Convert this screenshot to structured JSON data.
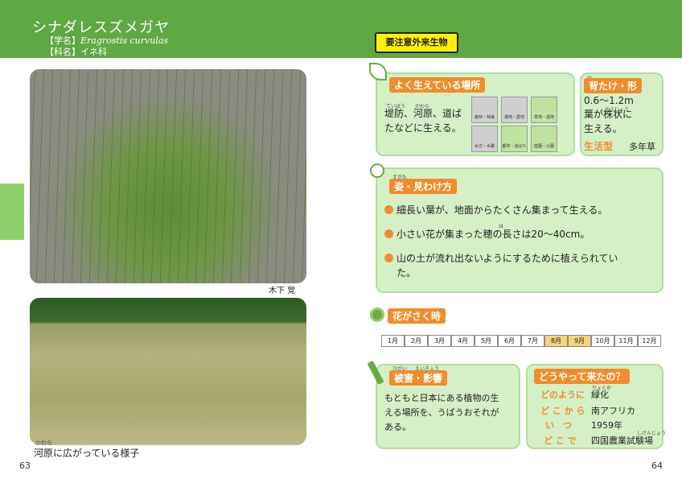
{
  "header": {
    "title": "シナダレスズメガヤ",
    "sci_label": "【学名】",
    "sci_name": "Eragrostis curvulas",
    "family_label": "【科名】",
    "family": "イネ科"
  },
  "photos": {
    "credit": "木下 覚",
    "caption_ruby": "かわら",
    "caption": "河原に広がっている様子"
  },
  "page_numbers": {
    "left": "63",
    "right": "64"
  },
  "badge": "要注意外来生物",
  "habitat": {
    "title": "よく生えている場所",
    "ruby1": "ていぼう",
    "ruby2": "かわら",
    "text1": "堤防、河原、道ば",
    "text2": "たなどに生える。",
    "icons": [
      {
        "label": "森林・林縁"
      },
      {
        "label": "畑地・農地"
      },
      {
        "label": "草地・湿地"
      },
      {
        "label": "水辺・水路"
      },
      {
        "label": "都市・道ばた"
      },
      {
        "label": "庭園・公園"
      }
    ]
  },
  "height": {
    "title": "背たけ・形",
    "title_ruby": "せ",
    "value": "0.6〜1.2m",
    "ruby": "かぶじょう",
    "shape1": "葉が株状に",
    "shape2": "生える。",
    "life_label": "生活型",
    "life_value": "多年草"
  },
  "appearance": {
    "title": "姿・見わけ方",
    "title_ruby": "すがた",
    "ruby_ho": "ほ",
    "bullets": [
      "細長い葉が、地面からたくさん集まって生える。",
      "小さい花が集まった穂の長さは20〜40cm。",
      "山の土が流れ出ないようにするために植えられてい",
      "た。"
    ]
  },
  "flowering": {
    "title": "花がさく時",
    "months": [
      "1月",
      "2月",
      "3月",
      "4月",
      "5月",
      "6月",
      "7月",
      "8月",
      "9月",
      "10月",
      "11月",
      "12月"
    ],
    "active": [
      false,
      false,
      false,
      false,
      false,
      false,
      false,
      true,
      true,
      false,
      false,
      false
    ]
  },
  "damage": {
    "title": "被害・影響",
    "ruby1": "ひがい",
    "ruby2": "えいきょう",
    "text": [
      "もともと日本にある植物の生",
      "える場所を、うばうおそれが",
      "ある。"
    ]
  },
  "origin": {
    "title": "どうやって来たの？",
    "rows": [
      {
        "label": "どのように",
        "value": "緑化"
      },
      {
        "label": "ど こ か ら",
        "value": "南アフリカ"
      },
      {
        "label": "い　つ",
        "value": "1959年"
      },
      {
        "label": "ど こ で",
        "value": "四国農業試験場"
      }
    ],
    "ruby_ryokuka": "りょくか",
    "ruby_shiken": "しけんじょう"
  },
  "colors": {
    "accent_green": "#5fa843",
    "orange": "#f28c2a",
    "panel": "#d5f0c7",
    "badge": "#fff200"
  }
}
